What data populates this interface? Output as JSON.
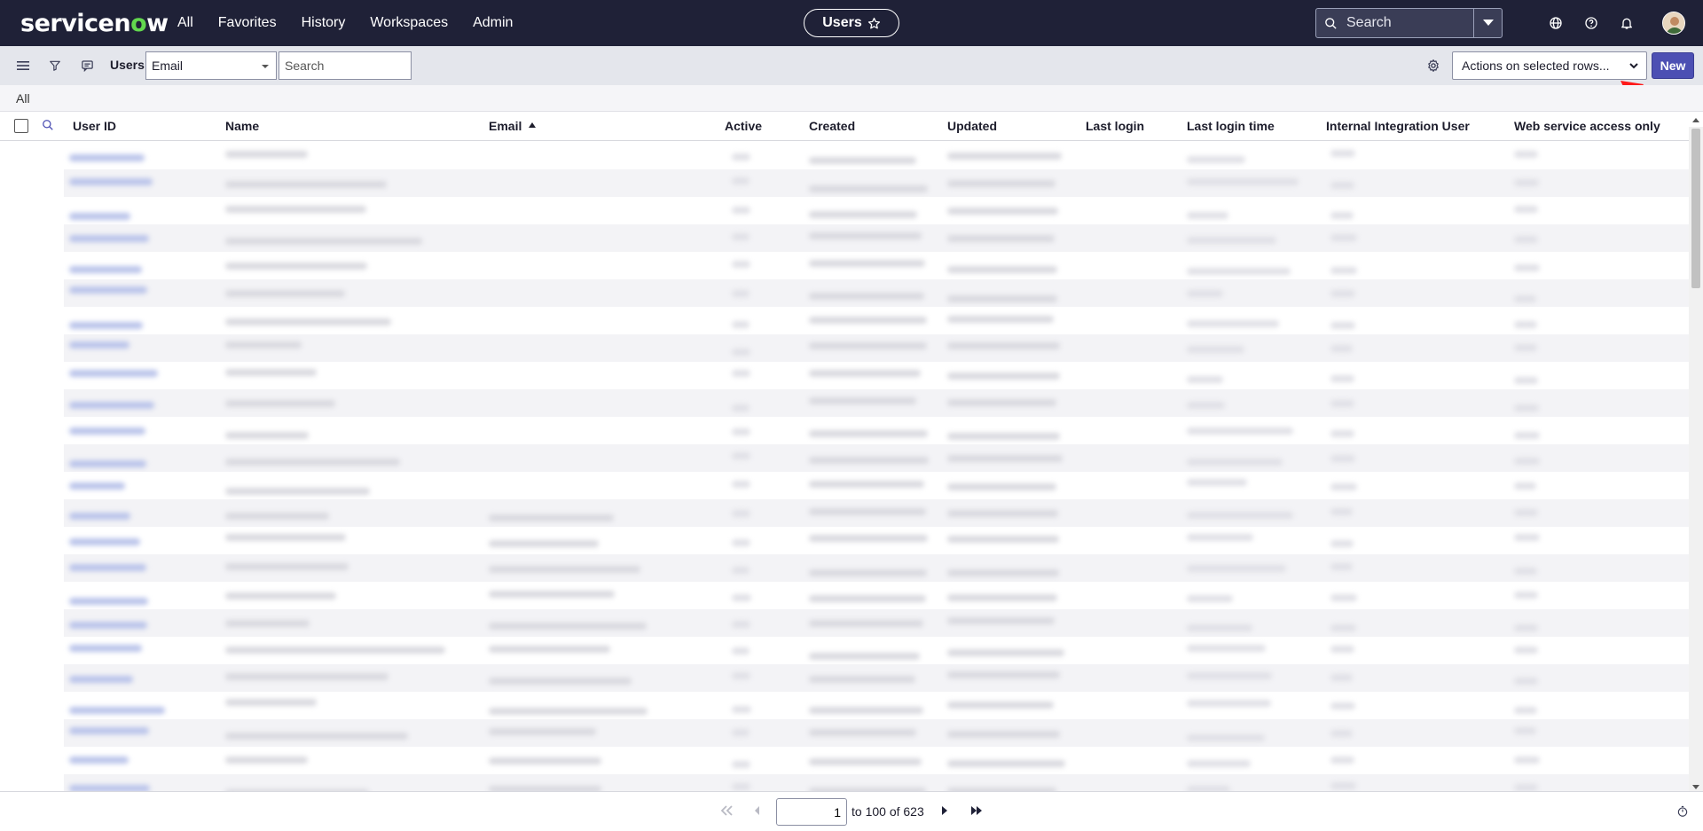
{
  "topnav": {
    "logo": {
      "prefix": "servicen",
      "o": "o",
      "suffix": "w"
    },
    "menu": [
      "All",
      "Favorites",
      "History",
      "Workspaces",
      "Admin"
    ],
    "context_title": "Users",
    "search_placeholder": "Search"
  },
  "toolbar": {
    "list_title": "Users",
    "field_select_value": "Email",
    "search_placeholder": "Search",
    "actions_label": "Actions on selected rows...",
    "new_label": "New"
  },
  "breadcrumb": {
    "label": "All"
  },
  "table": {
    "columns": [
      "User ID",
      "Name",
      "Email",
      "Active",
      "Created",
      "Updated",
      "Last login",
      "Last login time",
      "Internal Integration User",
      "Web service access only"
    ],
    "sorted_column": "Email"
  },
  "pager": {
    "page_value": "1",
    "range_text": "to 100 of 623"
  },
  "colors": {
    "nav_bg": "#1f2137",
    "accent": "#4c4fb3",
    "logo_o": "#62d84e",
    "annotation_arrow": "#ff1a1a"
  }
}
